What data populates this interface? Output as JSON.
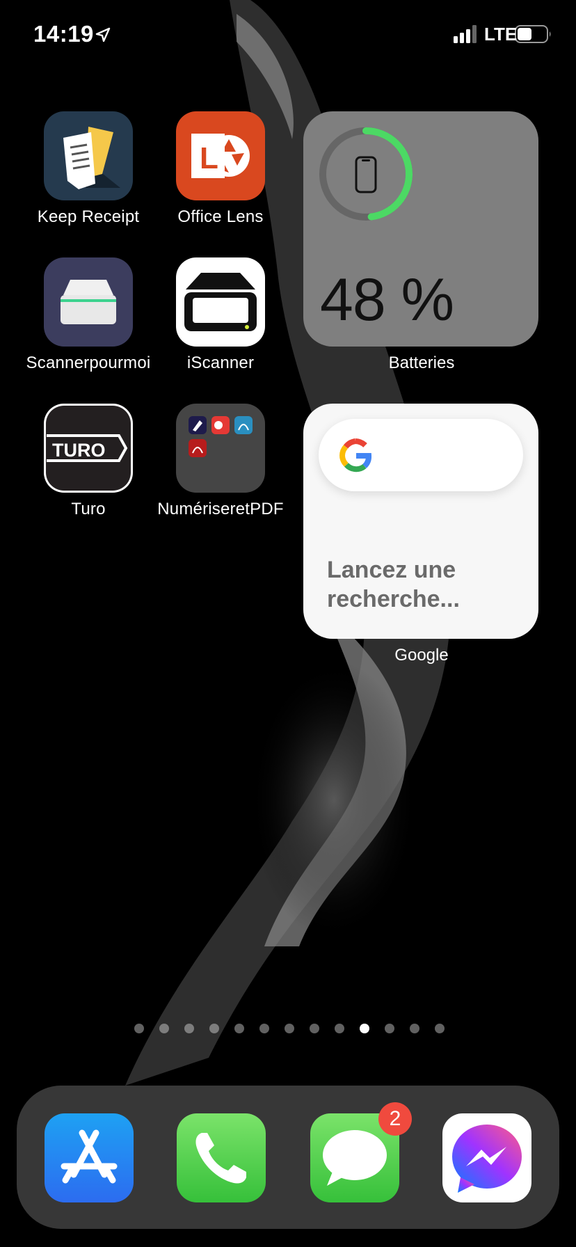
{
  "status_bar": {
    "time": "14:19",
    "network": "LTE",
    "icons": [
      "location-arrow-icon",
      "signal-icon",
      "battery-icon"
    ]
  },
  "apps": [
    {
      "name": "keep-receipt",
      "label": "Keep Receipt",
      "icon": "receipt-icon"
    },
    {
      "name": "office-lens",
      "label": "Office Lens",
      "icon": "office-lens-icon"
    },
    {
      "name": "scanner-pour-moi",
      "label": "Scannerpourmoi",
      "icon": "scanner-icon"
    },
    {
      "name": "iscanner",
      "label": "iScanner",
      "icon": "iscanner-icon"
    },
    {
      "name": "turo",
      "label": "Turo",
      "icon": "turo-icon",
      "icon_text": "TURO"
    },
    {
      "name": "numeriser-pdf-folder",
      "label": "NumériseretPDF",
      "icon": "folder-icon"
    }
  ],
  "widgets": {
    "battery": {
      "label": "Batteries",
      "percent_text": "48 %",
      "level": 0.48,
      "color": "#4cd964"
    },
    "google": {
      "label": "Google",
      "prompt": "Lancez une recherche..."
    }
  },
  "page_indicator": {
    "count": 13,
    "active_index": 9
  },
  "dock": [
    {
      "name": "app-store",
      "icon": "app-store-icon"
    },
    {
      "name": "phone",
      "icon": "phone-icon"
    },
    {
      "name": "messages",
      "icon": "messages-icon",
      "badge": "2"
    },
    {
      "name": "messenger",
      "icon": "messenger-icon"
    }
  ],
  "colors": {
    "badge": "#f04a3e",
    "battery_ring": "#4cd964",
    "messages_green": "#4cd964"
  }
}
